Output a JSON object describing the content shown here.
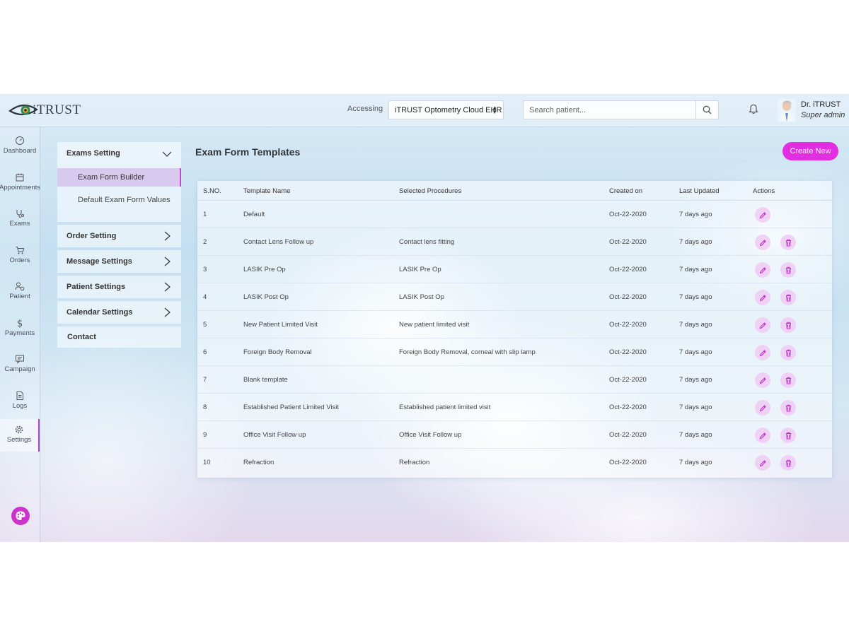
{
  "app": {
    "brand": "iTRUST"
  },
  "header": {
    "accessing_label": "Accessing",
    "org_selected": "iTRUST Optometry Cloud EHR",
    "search_placeholder": "Search patient...",
    "user_name": "Dr. iTRUST",
    "user_role": "Super admin"
  },
  "rail": {
    "items": [
      {
        "label": "Dashboard",
        "icon": "gauge-icon"
      },
      {
        "label": "Appointments",
        "icon": "calendar-icon"
      },
      {
        "label": "Exams",
        "icon": "stethoscope-icon"
      },
      {
        "label": "Orders",
        "icon": "cart-icon"
      },
      {
        "label": "Patient",
        "icon": "patient-icon"
      },
      {
        "label": "Payments",
        "icon": "dollar-icon"
      },
      {
        "label": "Campaign",
        "icon": "message-icon"
      },
      {
        "label": "Logs",
        "icon": "document-icon"
      },
      {
        "label": "Settings",
        "icon": "gear-icon"
      }
    ],
    "active": "Settings"
  },
  "settings_menu": {
    "exams_setting": "Exams Setting",
    "exam_form_builder": "Exam Form Builder",
    "default_exam_form_values": "Default Exam Form Values",
    "order_setting": "Order Setting",
    "message_settings": "Message Settings",
    "patient_settings": "Patient Settings",
    "calendar_settings": "Calendar Settings",
    "contact": "Contact"
  },
  "main": {
    "title": "Exam Form Templates",
    "create_label": "Create New",
    "columns": {
      "sno": "S.NO.",
      "name": "Template Name",
      "procedures": "Selected Procedures",
      "created": "Created on",
      "updated": "Last Updated",
      "actions": "Actions"
    },
    "rows": [
      {
        "sno": "1",
        "name": "Default",
        "procedures": "",
        "created": "Oct-22-2020",
        "updated": "7 days ago",
        "deletable": false
      },
      {
        "sno": "2",
        "name": "Contact Lens Follow up",
        "procedures": "Contact lens fitting",
        "created": "Oct-22-2020",
        "updated": "7 days ago",
        "deletable": true
      },
      {
        "sno": "3",
        "name": "LASIK Pre Op",
        "procedures": "LASIK Pre Op",
        "created": "Oct-22-2020",
        "updated": "7 days ago",
        "deletable": true
      },
      {
        "sno": "4",
        "name": "LASIK Post Op",
        "procedures": "LASIK Post Op",
        "created": "Oct-22-2020",
        "updated": "7 days ago",
        "deletable": true
      },
      {
        "sno": "5",
        "name": "New Patient Limited Visit",
        "procedures": "New patient limited visit",
        "created": "Oct-22-2020",
        "updated": "7 days ago",
        "deletable": true
      },
      {
        "sno": "6",
        "name": "Foreign Body Removal",
        "procedures": "Foreign Body Removal, corneal with slip lamp",
        "created": "Oct-22-2020",
        "updated": "7 days ago",
        "deletable": true
      },
      {
        "sno": "7",
        "name": "Blank template",
        "procedures": "",
        "created": "Oct-22-2020",
        "updated": "7 days ago",
        "deletable": true
      },
      {
        "sno": "8",
        "name": "Established Patient Limited Visit",
        "procedures": "Established patient limited visit",
        "created": "Oct-22-2020",
        "updated": "7 days ago",
        "deletable": true
      },
      {
        "sno": "9",
        "name": "Office Visit Follow up",
        "procedures": "Office Visit Follow up",
        "created": "Oct-22-2020",
        "updated": "7 days ago",
        "deletable": true
      },
      {
        "sno": "10",
        "name": "Refraction",
        "procedures": "Refraction",
        "created": "Oct-22-2020",
        "updated": "7 days ago",
        "deletable": true
      }
    ]
  },
  "colors": {
    "accent": "#e12ee1",
    "active_marker": "#b044c8",
    "action_bg": "#f0cdf5",
    "action_icon": "#c030c8"
  }
}
